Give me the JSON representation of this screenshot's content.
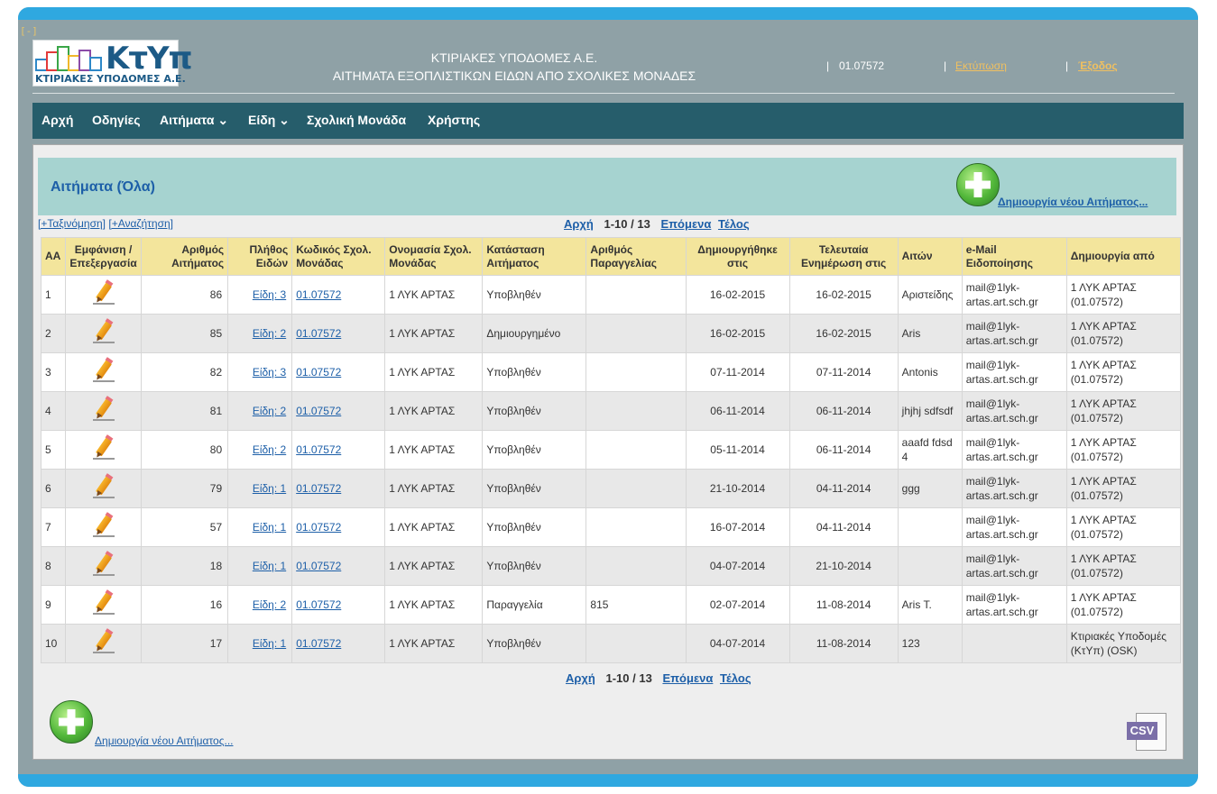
{
  "header": {
    "collapse_label": "[-]",
    "logo_text": "ΚτΥπ",
    "logo_subtitle": "ΚΤΙΡΙΑΚΕΣ ΥΠΟΔΟΜΕΣ Α.Ε.",
    "title_line1": "ΚΤΙΡΙΑΚΕΣ ΥΠΟΔΟΜΕΣ Α.Ε.",
    "title_line2": "ΑΙΤΗΜΑΤΑ ΕΞΟΠΛΙΣΤΙΚΩΝ ΕΙΔΩΝ ΑΠΟ ΣΧΟΛΙΚΕΣ ΜΟΝΑΔΕΣ",
    "user_code": "01.07572",
    "print_label": "Εκτύπωση",
    "logout_label": "Έξοδος",
    "separator": "|"
  },
  "nav": {
    "items": [
      {
        "label": "Αρχή"
      },
      {
        "label": "Οδηγίες"
      },
      {
        "label": "Αιτήματα",
        "caret": "⌄"
      },
      {
        "label": "Είδη",
        "caret": "⌄"
      },
      {
        "label": "Σχολική Μονάδα"
      },
      {
        "label": "Χρήστης"
      }
    ]
  },
  "panel": {
    "title": "Αιτήματα (Όλα)",
    "create_label": " Δημιουργία νέου Αιτήματος...",
    "create_label_bottom": "Δημιουργία νέου Αιτήματος...",
    "sort_label": "[+Ταξινόμηση]",
    "search_label": "[+Αναζήτηση]",
    "csv_label": "CSV"
  },
  "pager": {
    "first": "Αρχή",
    "range": "1-10 / 13",
    "next": "Επόμενα",
    "last": "Τέλος"
  },
  "table": {
    "headers": [
      "ΑΑ",
      "Εμφάνιση / Επεξεργασία",
      "Αριθμός Αιτήματος",
      "Πλήθος Ειδών",
      "Κωδικός Σχολ. Μονάδας",
      "Ονομασία Σχολ. Μονάδας",
      "Κατάσταση Αιτήματος",
      "Αριθμός Παραγγελίας",
      "Δημιουργήθηκε στις",
      "Τελευταία Ενημέρωση στις",
      "Αιτών",
      "e-Mail Ειδοποίησης",
      "Δημιουργία από"
    ],
    "rows": [
      {
        "aa": "1",
        "num": "86",
        "items": "Είδη: 3 ",
        "code": "01.07572 ",
        "name": "1 ΛΥΚ ΑΡΤΑΣ",
        "status": "Υποβληθέν",
        "order": "",
        "created": "16-02-2015",
        "updated": "16-02-2015",
        "applicant": "Αριστείδης",
        "email": "mail@1lyk-artas.art.sch.gr",
        "by": "1 ΛΥΚ ΑΡΤΑΣ (01.07572)"
      },
      {
        "aa": "2",
        "num": "85",
        "items": "Είδη: 2 ",
        "code": "01.07572 ",
        "name": "1 ΛΥΚ ΑΡΤΑΣ",
        "status": "Δημιουργημένο",
        "order": "",
        "created": "16-02-2015",
        "updated": "16-02-2015",
        "applicant": "Aris",
        "email": "mail@1lyk-artas.art.sch.gr",
        "by": "1 ΛΥΚ ΑΡΤΑΣ (01.07572)"
      },
      {
        "aa": "3",
        "num": "82",
        "items": "Είδη: 3 ",
        "code": "01.07572 ",
        "name": "1 ΛΥΚ ΑΡΤΑΣ",
        "status": "Υποβληθέν",
        "order": "",
        "created": "07-11-2014",
        "updated": "07-11-2014",
        "applicant": "Antonis",
        "email": "mail@1lyk-artas.art.sch.gr",
        "by": "1 ΛΥΚ ΑΡΤΑΣ (01.07572)"
      },
      {
        "aa": "4",
        "num": "81",
        "items": "Είδη: 2 ",
        "code": "01.07572 ",
        "name": "1 ΛΥΚ ΑΡΤΑΣ",
        "status": "Υποβληθέν",
        "order": "",
        "created": "06-11-2014",
        "updated": "06-11-2014",
        "applicant": "jhjhj sdfsdf",
        "email": "mail@1lyk-artas.art.sch.gr",
        "by": "1 ΛΥΚ ΑΡΤΑΣ (01.07572)"
      },
      {
        "aa": "5",
        "num": "80",
        "items": "Είδη: 2 ",
        "code": "01.07572 ",
        "name": "1 ΛΥΚ ΑΡΤΑΣ",
        "status": "Υποβληθέν",
        "order": "",
        "created": "05-11-2014",
        "updated": "06-11-2014",
        "applicant": "aaafd fdsd 4",
        "email": "mail@1lyk-artas.art.sch.gr",
        "by": "1 ΛΥΚ ΑΡΤΑΣ (01.07572)"
      },
      {
        "aa": "6",
        "num": "79",
        "items": "Είδη: 1 ",
        "code": "01.07572 ",
        "name": "1 ΛΥΚ ΑΡΤΑΣ",
        "status": "Υποβληθέν",
        "order": "",
        "created": "21-10-2014",
        "updated": "04-11-2014",
        "applicant": "ggg",
        "email": "mail@1lyk-artas.art.sch.gr",
        "by": "1 ΛΥΚ ΑΡΤΑΣ (01.07572)"
      },
      {
        "aa": "7",
        "num": "57",
        "items": "Είδη: 1 ",
        "code": "01.07572 ",
        "name": "1 ΛΥΚ ΑΡΤΑΣ",
        "status": "Υποβληθέν",
        "order": "",
        "created": "16-07-2014",
        "updated": "04-11-2014",
        "applicant": "",
        "email": "mail@1lyk-artas.art.sch.gr",
        "by": "1 ΛΥΚ ΑΡΤΑΣ (01.07572)"
      },
      {
        "aa": "8",
        "num": "18",
        "items": "Είδη: 1 ",
        "code": "01.07572 ",
        "name": "1 ΛΥΚ ΑΡΤΑΣ",
        "status": "Υποβληθέν",
        "order": "",
        "created": "04-07-2014",
        "updated": "21-10-2014",
        "applicant": "",
        "email": "mail@1lyk-artas.art.sch.gr",
        "by": "1 ΛΥΚ ΑΡΤΑΣ (01.07572)"
      },
      {
        "aa": "9",
        "num": "16",
        "items": "Είδη: 2 ",
        "code": "01.07572 ",
        "name": "1 ΛΥΚ ΑΡΤΑΣ",
        "status": "Παραγγελία",
        "order": "815",
        "created": "02-07-2014",
        "updated": "11-08-2014",
        "applicant": "Aris T.",
        "email": "mail@1lyk-artas.art.sch.gr",
        "by": "1 ΛΥΚ ΑΡΤΑΣ (01.07572)"
      },
      {
        "aa": "10",
        "num": "17",
        "items": "Είδη: 1 ",
        "code": "01.07572 ",
        "name": "1 ΛΥΚ ΑΡΤΑΣ",
        "status": "Υποβληθέν",
        "order": "",
        "created": "04-07-2014",
        "updated": "11-08-2014",
        "applicant": "123",
        "email": "",
        "by": "Κτιριακές Υποδομές (ΚτΥπ) (OSK)"
      }
    ]
  },
  "colors": {
    "frame": "#8fa1a6",
    "accent_bar": "#2fa8e0",
    "nav": "#265d6b",
    "panel_head": "#a6d3d0",
    "table_header": "#f3e59c",
    "link": "#1d5fa8"
  },
  "icons": {
    "edit": "pencil-icon",
    "create": "plus-circle-icon",
    "export": "csv-file-icon"
  }
}
